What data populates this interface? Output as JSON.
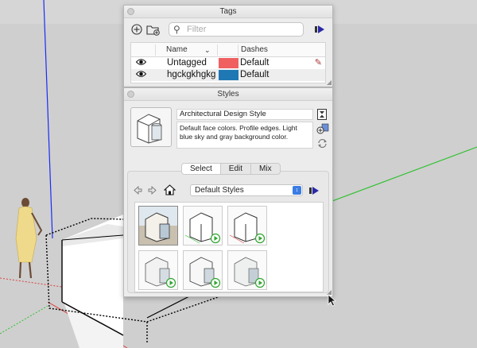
{
  "tags": {
    "title": "Tags",
    "filter_placeholder": "Filter",
    "columns": {
      "name": "Name",
      "dashes": "Dashes"
    },
    "rows": [
      {
        "name": "Untagged",
        "color": "#f06060",
        "dashes": "Default"
      },
      {
        "name": "hgckgkhgkg",
        "color": "#1f78b4",
        "dashes": "Default"
      }
    ]
  },
  "styles": {
    "title": "Styles",
    "style_name": "Architectural Design Style",
    "description": "Default face colors. Profile edges. Light blue sky and gray background color.",
    "tabs": [
      {
        "label": "Select",
        "active": true
      },
      {
        "label": "Edit",
        "active": false
      },
      {
        "label": "Mix",
        "active": false
      }
    ],
    "collection": "Default Styles"
  },
  "colors": {
    "axis_blue": "#1a2cf5",
    "axis_green": "#2fc12f",
    "axis_red": "#d94141",
    "viewport_bg": "#cfcfcf",
    "accent": "#3b7de3"
  }
}
